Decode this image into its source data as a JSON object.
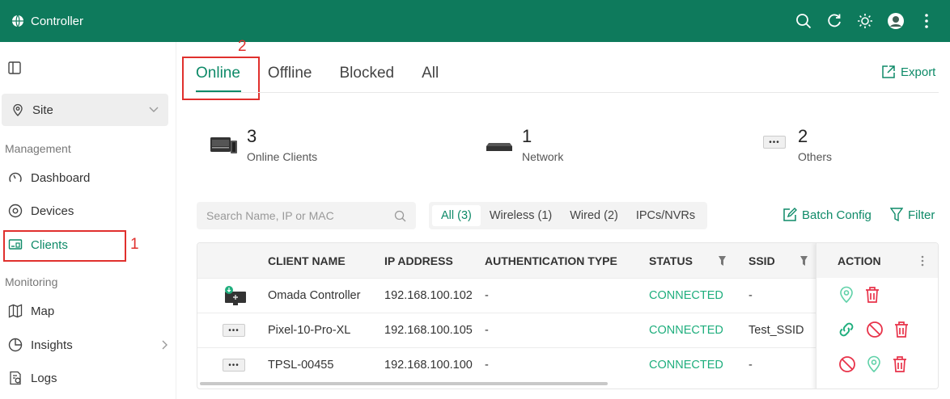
{
  "app": {
    "title": "Controller"
  },
  "sidebar": {
    "site": "Site",
    "sections": {
      "management": "Management",
      "monitoring": "Monitoring"
    },
    "items": [
      {
        "label": "Dashboard"
      },
      {
        "label": "Devices"
      },
      {
        "label": "Clients"
      },
      {
        "label": "Map"
      },
      {
        "label": "Insights"
      },
      {
        "label": "Logs"
      }
    ]
  },
  "annotations": {
    "marker1": "1",
    "marker2": "2"
  },
  "tabs": [
    {
      "label": "Online"
    },
    {
      "label": "Offline"
    },
    {
      "label": "Blocked"
    },
    {
      "label": "All"
    }
  ],
  "export_label": "Export",
  "stats": [
    {
      "value": "3",
      "label": "Online Clients"
    },
    {
      "value": "1",
      "label": "Network"
    },
    {
      "value": "2",
      "label": "Others"
    }
  ],
  "search": {
    "placeholder": "Search Name, IP or MAC"
  },
  "segments": [
    {
      "label": "All (3)"
    },
    {
      "label": "Wireless (1)"
    },
    {
      "label": "Wired (2)"
    },
    {
      "label": "IPCs/NVRs"
    }
  ],
  "batch_label": "Batch Config",
  "filter_label": "Filter",
  "table": {
    "headers": {
      "name": "CLIENT NAME",
      "ip": "IP ADDRESS",
      "auth": "AUTHENTICATION TYPE",
      "status": "STATUS",
      "ssid": "SSID",
      "action": "ACTION"
    },
    "rows": [
      {
        "name": "Omada Controller",
        "ip": "192.168.100.102",
        "auth": "-",
        "status": "CONNECTED",
        "ssid": "-"
      },
      {
        "name": "Pixel-10-Pro-XL",
        "ip": "192.168.100.105",
        "auth": "-",
        "status": "CONNECTED",
        "ssid": "Test_SSID"
      },
      {
        "name": "TPSL-00455",
        "ip": "192.168.100.100",
        "auth": "-",
        "status": "CONNECTED",
        "ssid": "-"
      }
    ]
  },
  "colors": {
    "brand": "#0e7a5c",
    "accent": "#0e8a68",
    "status_green": "#1fae7d",
    "danger": "#e0302d"
  }
}
